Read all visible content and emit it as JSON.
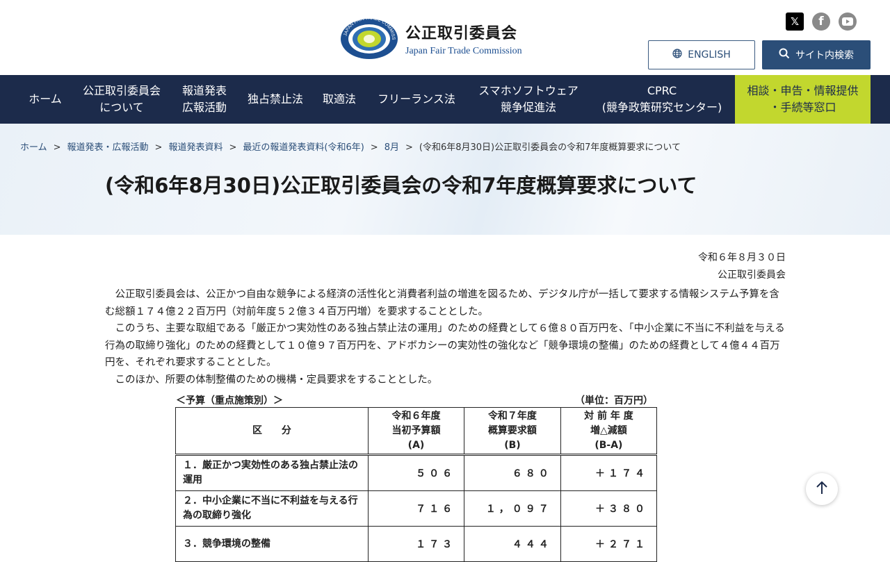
{
  "header": {
    "brand_ja": "公正取引委員会",
    "brand_en": "Japan Fair Trade Commission",
    "logo_text": "JAPAN FAIR TRADE COMMISSION",
    "social": [
      "x-icon",
      "facebook-icon",
      "youtube-icon"
    ],
    "english_label": "ENGLISH",
    "search_label": "サイト内検索"
  },
  "nav": {
    "items": [
      {
        "label": "ホーム"
      },
      {
        "label": "公正取引委員会\nについて"
      },
      {
        "label": "報道発表\n広報活動"
      },
      {
        "label": "独占禁止法"
      },
      {
        "label": "取適法"
      },
      {
        "label": "フリーランス法"
      },
      {
        "label": "スマホソフトウェア\n競争促進法"
      },
      {
        "label": "CPRC\n(競争政策研究センター)"
      },
      {
        "label": "相談・申告・情報提供\n・手続等窓口"
      }
    ]
  },
  "breadcrumb": {
    "links": [
      "ホーム",
      "報道発表・広報活動",
      "報道発表資料",
      "最近の報道発表資料(令和6年)",
      "8月"
    ],
    "current": "(令和6年8月30日)公正取引委員会の令和7年度概算要求について",
    "separator": ">"
  },
  "page": {
    "title": "(令和6年8月30日)公正取引委員会の令和7年度概算要求について",
    "date": "令和６年８月３０日",
    "org": "公正取引委員会",
    "paragraphs": [
      "公正取引委員会は、公正かつ自由な競争による経済の活性化と消費者利益の増進を図るため、デジタル庁が一括して要求する情報システム予算を含む総額１７４億２２百万円（対前年度５２億３４百万円増）を要求することとした。",
      "このうち、主要な取組である「厳正かつ実効性のある独占禁止法の運用」のための経費として６億８０百万円を、「中小企業に不当に不利益を与える行為の取締り強化」のための経費として１０億９７百万円を、アドボカシーの実効性の強化など「競争環境の整備」のための経費として４億４４百万円を、それぞれ要求することとした。",
      "このほか、所要の体制整備のための機構・定員要求をすることとした。"
    ]
  },
  "budget_table": {
    "caption": "＜予算（重点施策別）＞",
    "unit": "（単位：百万円）",
    "headers": [
      "区　　分",
      "令和６年度\n当初予算額\n(A)",
      "令和７年度\n概算要求額\n(B)",
      "対 前 年 度\n増△減額\n(B-A)"
    ],
    "rows": [
      {
        "item": "１．厳正かつ実効性のある独占禁止法の運用",
        "a": "５０６",
        "b": "６８０",
        "diff": "＋１７４"
      },
      {
        "item": "２．中小企業に不当に不利益を与える行為の取締り強化",
        "a": "７１６",
        "b": "１，０９７",
        "diff": "＋３８０"
      },
      {
        "item": "３．競争環境の整備",
        "a": "１７３",
        "b": "４４４",
        "diff": "＋２７１"
      }
    ]
  }
}
